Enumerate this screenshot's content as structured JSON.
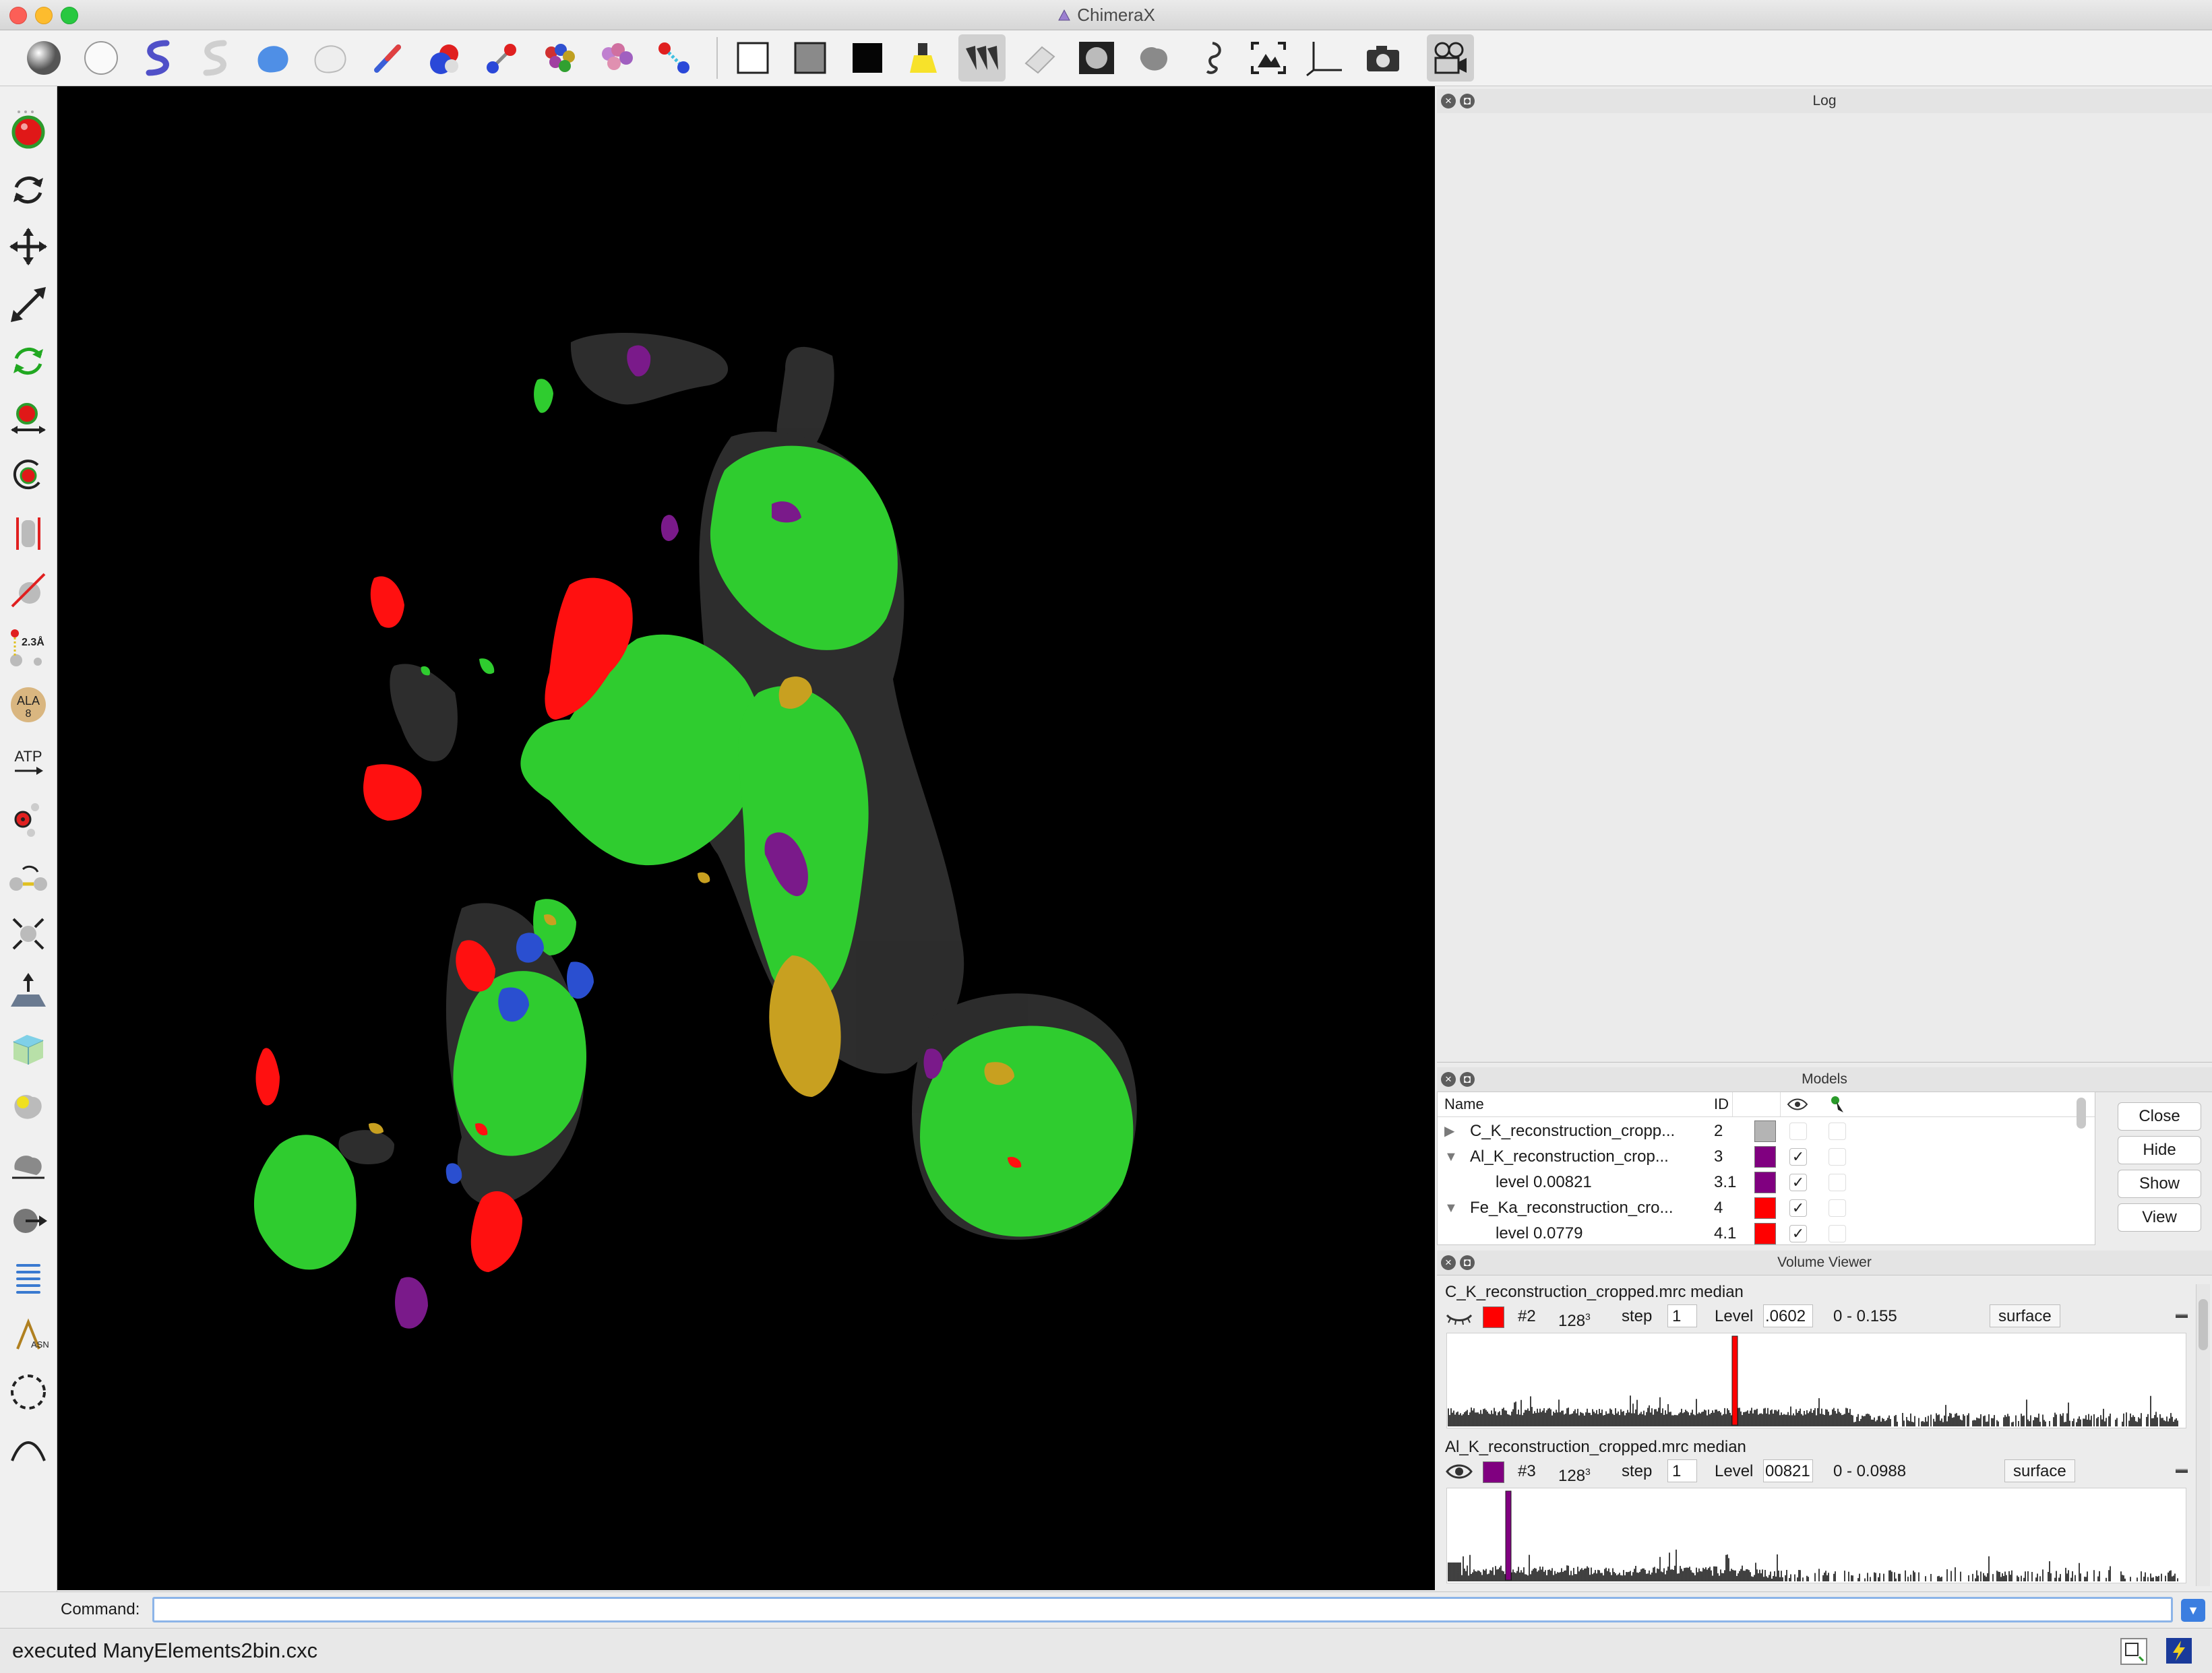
{
  "window": {
    "title": "ChimeraX"
  },
  "log_panel": {
    "title": "Log"
  },
  "models_panel": {
    "title": "Models",
    "columns": {
      "name": "Name",
      "id": "ID"
    },
    "rows": [
      {
        "name": "C_K_reconstruction_cropp...",
        "id": "2",
        "color": "#b4b4b4",
        "expand": "▶",
        "shown": false
      },
      {
        "name": "Al_K_reconstruction_crop...",
        "id": "3",
        "color": "#800080",
        "expand": "▼",
        "shown": true
      },
      {
        "name": "level 0.00821",
        "id": "3.1",
        "color": "#800080",
        "expand": "",
        "shown": true
      },
      {
        "name": "Fe_Ka_reconstruction_cro...",
        "id": "4",
        "color": "#ff0000",
        "expand": "▼",
        "shown": true
      },
      {
        "name": "level 0.0779",
        "id": "4.1",
        "color": "#ff0000",
        "expand": "",
        "shown": true
      }
    ],
    "buttons": {
      "close": "Close",
      "hide": "Hide",
      "show": "Show",
      "view": "View"
    }
  },
  "volume_viewer": {
    "title": "Volume Viewer",
    "maps": [
      {
        "name": "C_K_reconstruction_cropped.mrc median",
        "color": "#ff0000",
        "model": "#2",
        "size": "128",
        "size_exp": "3",
        "step_label": "step",
        "step": "1",
        "level_label": "Level",
        "level": ".0602",
        "range": "0 - 0.155",
        "style": "surface",
        "marker_fraction": 0.39
      },
      {
        "name": "Al_K_reconstruction_cropped.mrc median",
        "color": "#800080",
        "model": "#3",
        "size": "128",
        "size_exp": "3",
        "step_label": "step",
        "step": "1",
        "level_label": "Level",
        "level": "00821",
        "range": "0 - 0.0988",
        "style": "surface",
        "marker_fraction": 0.083
      }
    ]
  },
  "command_line": {
    "label": "Command:",
    "value": ""
  },
  "status_bar": {
    "message": "executed ManyElements2bin.cxc"
  },
  "colors": {
    "graphics_bg": "#000000",
    "green": "#2fcc2f",
    "red": "#ff1010",
    "purple": "#7a1a8a",
    "blue": "#2a4fd0",
    "gold": "#c8a020",
    "gray": "#303030"
  }
}
